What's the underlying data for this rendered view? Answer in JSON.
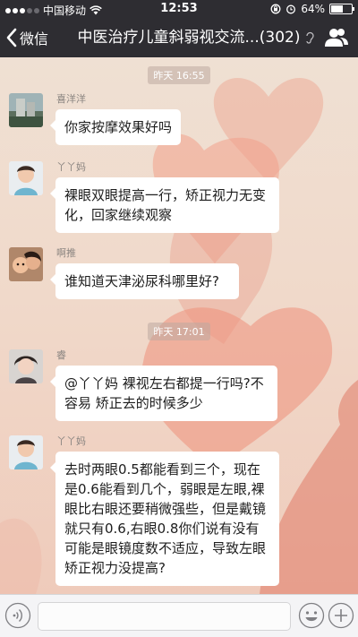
{
  "status_bar": {
    "carrier": "中国移动",
    "time": "12:53",
    "battery": "64%",
    "battery_level": 0.64
  },
  "nav": {
    "back_label": "微信",
    "title": "中医治疗儿童斜弱视交流...",
    "member_count": "(302)"
  },
  "dividers": [
    "昨天 16:55",
    "昨天 17:01"
  ],
  "messages": [
    {
      "sender": "喜洋洋",
      "text": "你家按摩效果好吗",
      "avatar": "building-photo"
    },
    {
      "sender": "丫丫妈",
      "text": "裸眼双眼提高一行，矫正视力无变化，回家继续观察",
      "avatar": "child-photo"
    },
    {
      "sender": "啊推",
      "text": "谁知道天津泌尿科哪里好?",
      "avatar": "mother-child-photo"
    },
    {
      "sender": "睿",
      "text": "@丫丫妈 裸视左右都提一行吗?不容易 矫正去的时候多少",
      "avatar": "woman-photo"
    },
    {
      "sender": "丫丫妈",
      "text": "去时两眼0.5都能看到三个，现在是0.6能看到几个，弱眼是左眼,裸眼比右眼还要稍微强些，但是戴镜就只有0.6,右眼0.8你们说有没有可能是眼镜度数不适应，导致左眼矫正视力没提高?",
      "avatar": "child-photo"
    }
  ],
  "input": {
    "value": ""
  }
}
